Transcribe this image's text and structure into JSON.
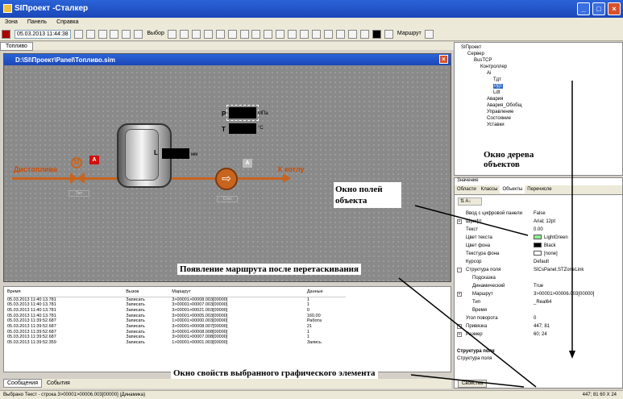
{
  "window": {
    "title": "SIПроект -Сталкер"
  },
  "menu": [
    "Зона",
    "Панель",
    "Справка"
  ],
  "toolbar": {
    "datetime": "05.03.2013 11:44:38",
    "select_label": "Выбор",
    "route_label": "Маршрут"
  },
  "doc_tab": "Топливо",
  "canvas_window": {
    "title": "D:\\SI\\Проект\\Panel\\Топливо.sim"
  },
  "canvas": {
    "label_left": "Дистоплива",
    "label_right": "К котлу",
    "unit_pressure": "МПа",
    "unit_temp": "°C",
    "unit_level": "мм",
    "p_letter": "P",
    "t_letter": "T",
    "l_letter": "L",
    "valve_letter": "M",
    "alarm_letter": "A",
    "pump_alarm_letter": "A",
    "valve_caption": "Зап",
    "pump_caption": "Стоп"
  },
  "log": {
    "columns": [
      "Время",
      "Вызов",
      "Маршрут",
      "Данные"
    ],
    "rows": [
      [
        "05.03.2013 11:40:13.781",
        "Записать",
        "3>00001>00008.003[00000]",
        "1"
      ],
      [
        "05.03.2013 11:40:13.781",
        "Записать",
        "3>00001>00007.003[00000]",
        "1"
      ],
      [
        "05.03.2013 11:40:13.781",
        "Записать",
        "3>00001>00021.003[00000]",
        "0"
      ],
      [
        "05.03.2013 11:40:13.781",
        "Записать",
        "3>00001>00005.003[00000]",
        "160.00"
      ],
      [
        "05.03.2013 11:39:52.687",
        "Записать",
        "1>00001>00000.003[00000]",
        "Работа"
      ],
      [
        "05.03.2013 11:39:52.687",
        "Записать",
        "3>00001>00008.007[00000]",
        "21"
      ],
      [
        "05.03.2013 11:39:52.687",
        "Записать",
        "3>00001>00008.008[00000]",
        "1"
      ],
      [
        "05.03.2013 11:39:52.687",
        "Записать",
        "3>00001>00007.008[00000]",
        "1"
      ],
      [
        "05.03.2013 11:39:52.359",
        "Записать",
        "1>00001>00001.003[00000]",
        "Запись"
      ]
    ],
    "tab_messages": "Сообщения",
    "tab_events": "События"
  },
  "status": {
    "left": "Выбрано Текст - строка 3>00001>00006.003[00000] (Динамика)",
    "right": "447; 81  60 X 24"
  },
  "tree": {
    "root": "SIПроект",
    "server": "Сервер",
    "bus": "BusTCP",
    "controller": "Контроллер",
    "ai": "Ai",
    "tdt": "Тдт",
    "pdt": "Рдт",
    "ldt": "Ldt",
    "alarm": "Авария",
    "alarm_gen": "Авария_Обобщ",
    "control": "Управление",
    "state": "Состояние",
    "settings": "Уставки"
  },
  "props": {
    "value_label": "Значение",
    "tabs": [
      "Области",
      "Классы",
      "Объекты",
      "Перечисле"
    ],
    "rows": [
      {
        "n": "Ввод с цифровой панели",
        "v": "False"
      },
      {
        "n": "Шрифт",
        "v": "Arial; 12pt",
        "ex": "+"
      },
      {
        "n": "Текст",
        "v": "0.00"
      },
      {
        "n": "Цвет текста",
        "v": "LightGreen",
        "color": "#90ee90"
      },
      {
        "n": "Цвет фона",
        "v": "Black",
        "color": "#000000"
      },
      {
        "n": "Текстура фона",
        "v": "[none]",
        "color": "#ffffff"
      },
      {
        "n": "Курсор",
        "v": "Default"
      },
      {
        "n": "Структура поля",
        "v": "SICsPanel.STZoneLink",
        "ex": "-"
      },
      {
        "n": "Подсказка",
        "v": "",
        "indent": true
      },
      {
        "n": "Динамический",
        "v": "True",
        "indent": true
      },
      {
        "n": "Маршрут",
        "v": "3>00001>00006.003[00000]",
        "ex": "+",
        "indent": true
      },
      {
        "n": "Тип",
        "v": "_Real64",
        "indent": true
      },
      {
        "n": "Время",
        "v": "",
        "indent": true
      },
      {
        "n": "Угол поворота",
        "v": "0"
      },
      {
        "n": "Привязка",
        "v": "447; 81",
        "ex": "+"
      },
      {
        "n": "Размер",
        "v": "60; 24",
        "ex": "+"
      }
    ],
    "desc_title": "Структура поля",
    "desc_text": "Структура поля",
    "bottom_tab": "Свойства"
  },
  "annotations": {
    "tree_window": "Окно дерева объектов",
    "fields_window": "Окно полей объекта",
    "route_appear": "Появление маршрута после перетаскивания",
    "props_window": "Окно свойств выбранного графического элемента"
  },
  "colors": {
    "pipe": "#c8641e",
    "title": "#1b47b8",
    "alarm_red": "#d01010"
  }
}
